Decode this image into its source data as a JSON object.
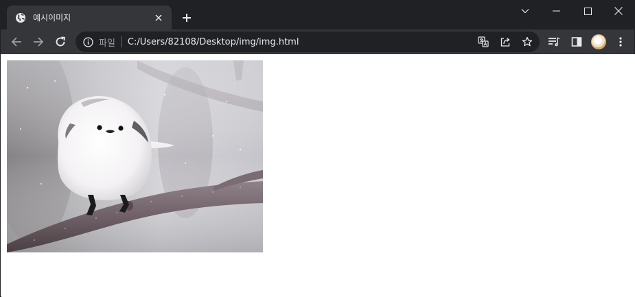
{
  "tab": {
    "title": "예시이미지",
    "favicon_icon": "globe-icon",
    "close_icon": "close-icon"
  },
  "new_tab_icon": "plus-icon",
  "window_controls": [
    "chevron-down-icon",
    "minimize-icon",
    "maximize-icon",
    "close-icon"
  ],
  "navigation": {
    "back_icon": "arrow-left-icon",
    "forward_icon": "arrow-right-icon",
    "reload_icon": "reload-icon"
  },
  "address_bar": {
    "info_icon": "info-icon",
    "chip_label": "파일",
    "url": "C:/Users/82108/Desktop/img/img.html",
    "action_icons": [
      "translate-icon",
      "share-icon",
      "star-icon"
    ]
  },
  "toolbar_icons": [
    "reading-list-icon",
    "side-panel-icon",
    "profile-avatar",
    "more-menu-icon"
  ],
  "page": {
    "image_subject": "white long-tailed tit perched on a branch"
  },
  "colors": {
    "frame": "#202124",
    "toolbar": "#35363a",
    "omnibox": "#202124",
    "text": "#e8eaed",
    "page_background": "#ffffff"
  }
}
